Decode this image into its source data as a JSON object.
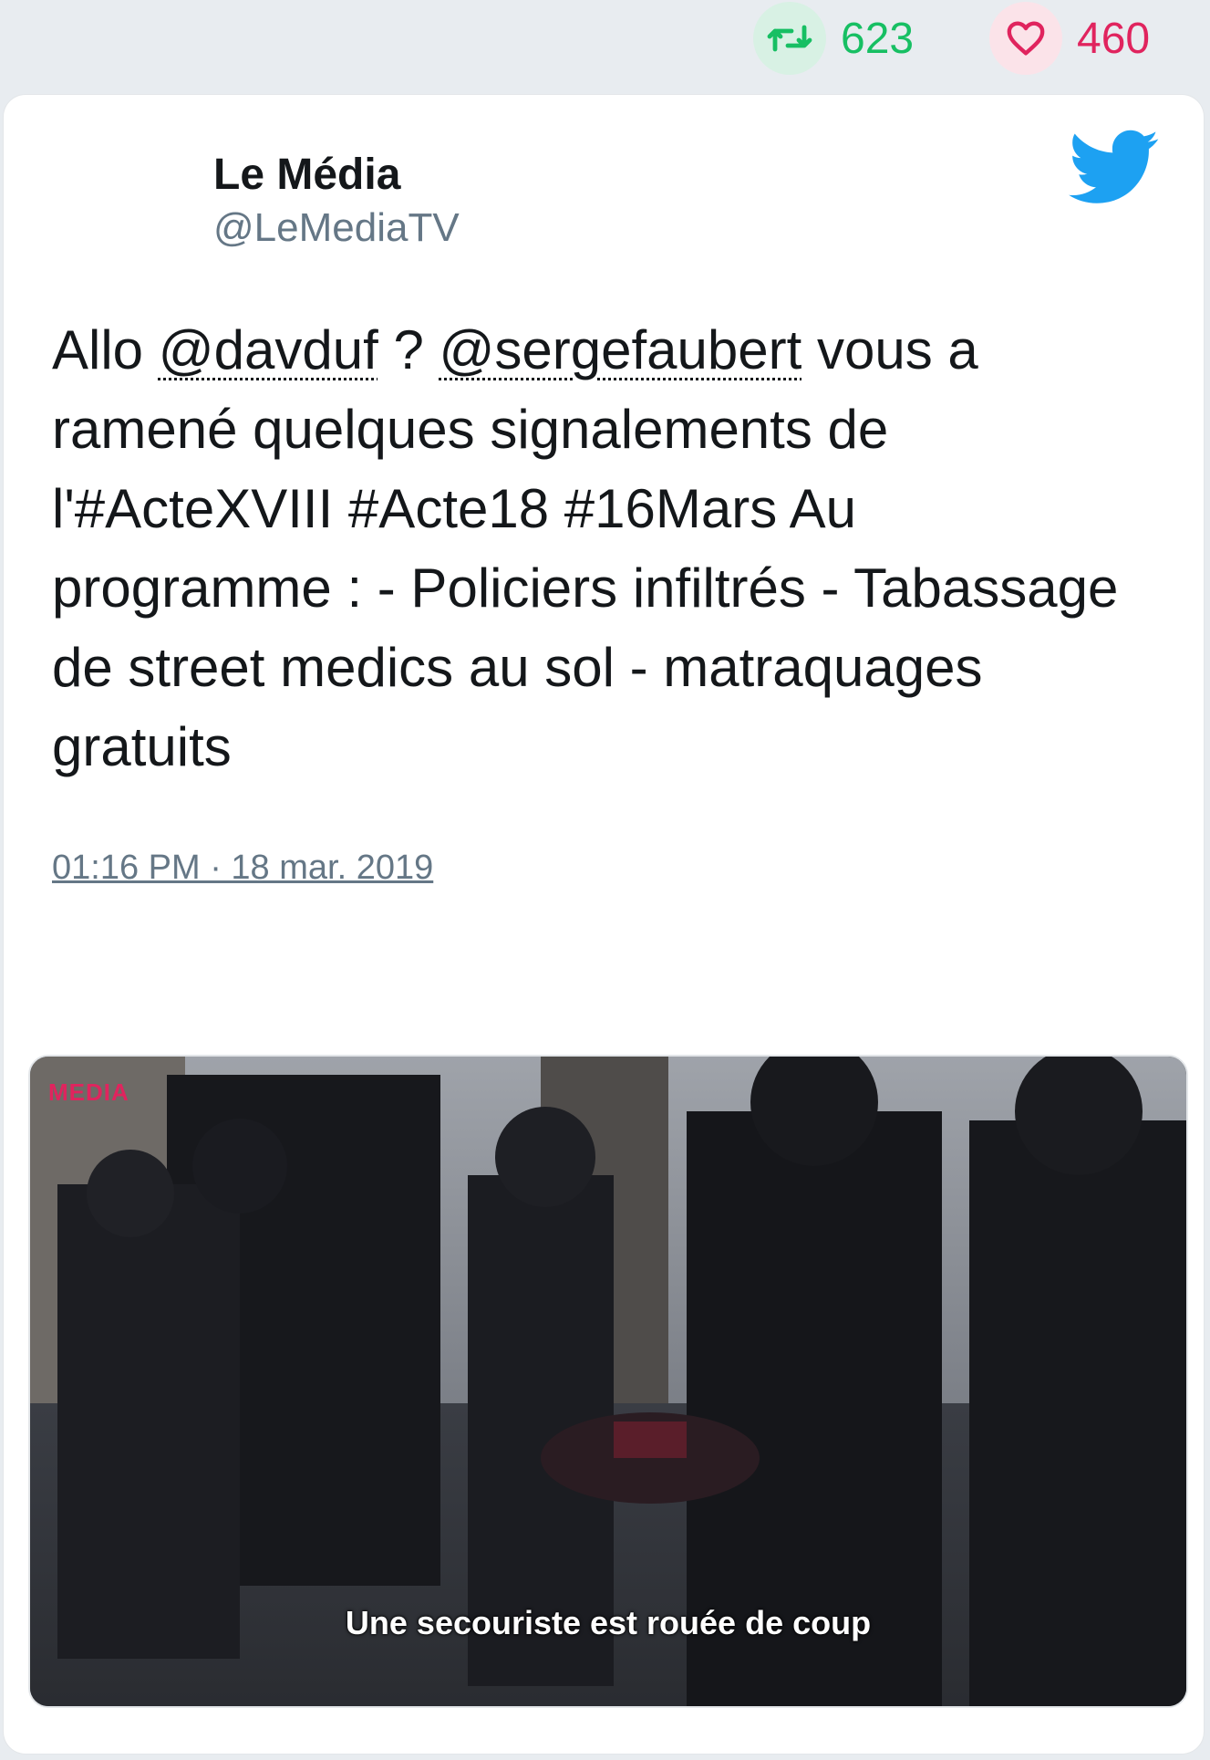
{
  "stats": {
    "retweets": "623",
    "likes": "460"
  },
  "tweet": {
    "author_name": "Le Média",
    "author_handle": "@LeMediaTV",
    "text_parts": {
      "p1": "Allo ",
      "mention1": "@davduf",
      "p2": " ? ",
      "mention2": "@sergefaubert",
      "p3": " vous a ramené quelques signalements de l'#ActeXVIII #Acte18 #16Mars Au programme : - Policiers infiltrés - Tabassage de street medics au sol - matraquages gratuits"
    },
    "timestamp": "01:16 PM · 18 mar. 2019"
  },
  "media": {
    "caption": "Une secouriste est rouée de coup",
    "watermark": "MEDIA"
  },
  "icons": {
    "retweet": "retweet-icon",
    "like": "heart-icon",
    "reply": "reply-icon",
    "brand": "twitter-bird-icon"
  },
  "colors": {
    "retweet": "#17bf63",
    "like": "#e0245e",
    "brand": "#1da1f2",
    "muted": "#657786"
  }
}
